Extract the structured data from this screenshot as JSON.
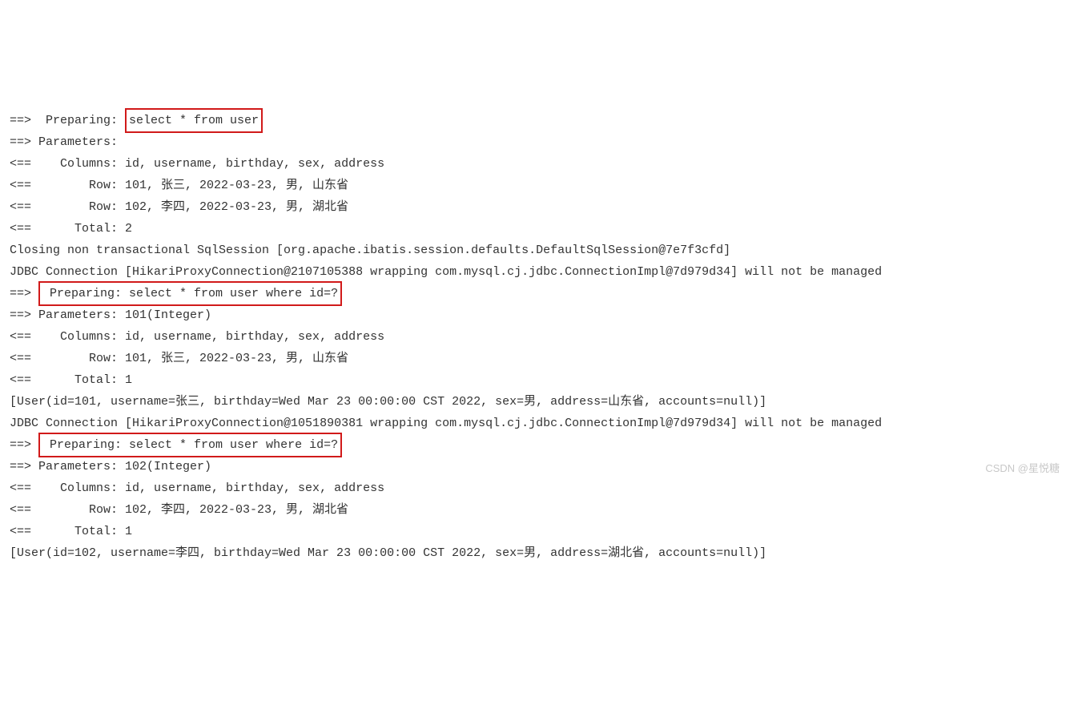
{
  "lines": {
    "l00": "==>  Preparing: ",
    "h00": "select * from user",
    "l01": "==> Parameters:",
    "l02": "<==    Columns: id, username, birthday, sex, address",
    "l03": "<==        Row: 101, 张三, 2022-03-23, 男, 山东省",
    "l04": "<==        Row: 102, 李四, 2022-03-23, 男, 湖北省",
    "l05": "<==      Total: 2",
    "l06": "Closing non transactional SqlSession [org.apache.ibatis.session.defaults.DefaultSqlSession@7e7f3cfd]",
    "l07": "JDBC Connection [HikariProxyConnection@2107105388 wrapping com.mysql.cj.jdbc.ConnectionImpl@7d979d34] will not be managed",
    "l08": "==> ",
    "h08": " Preparing: select * from user where id=?",
    "l09": "==> Parameters: 101(Integer)",
    "l10": "<==    Columns: id, username, birthday, sex, address",
    "l11": "<==        Row: 101, 张三, 2022-03-23, 男, 山东省",
    "l12": "<==      Total: 1",
    "l13": "[User(id=101, username=张三, birthday=Wed Mar 23 00:00:00 CST 2022, sex=男, address=山东省, accounts=null)]",
    "l14": "JDBC Connection [HikariProxyConnection@1051890381 wrapping com.mysql.cj.jdbc.ConnectionImpl@7d979d34] will not be managed",
    "l15": "==> ",
    "h15": " Preparing: select * from user where id=?",
    "l16": "==> Parameters: 102(Integer)",
    "l17": "<==    Columns: id, username, birthday, sex, address",
    "l18": "<==        Row: 102, 李四, 2022-03-23, 男, 湖北省",
    "l19": "<==      Total: 1",
    "l20": "[User(id=102, username=李四, birthday=Wed Mar 23 00:00:00 CST 2022, sex=男, address=湖北省, accounts=null)]"
  },
  "watermark": "CSDN @星悦糖"
}
